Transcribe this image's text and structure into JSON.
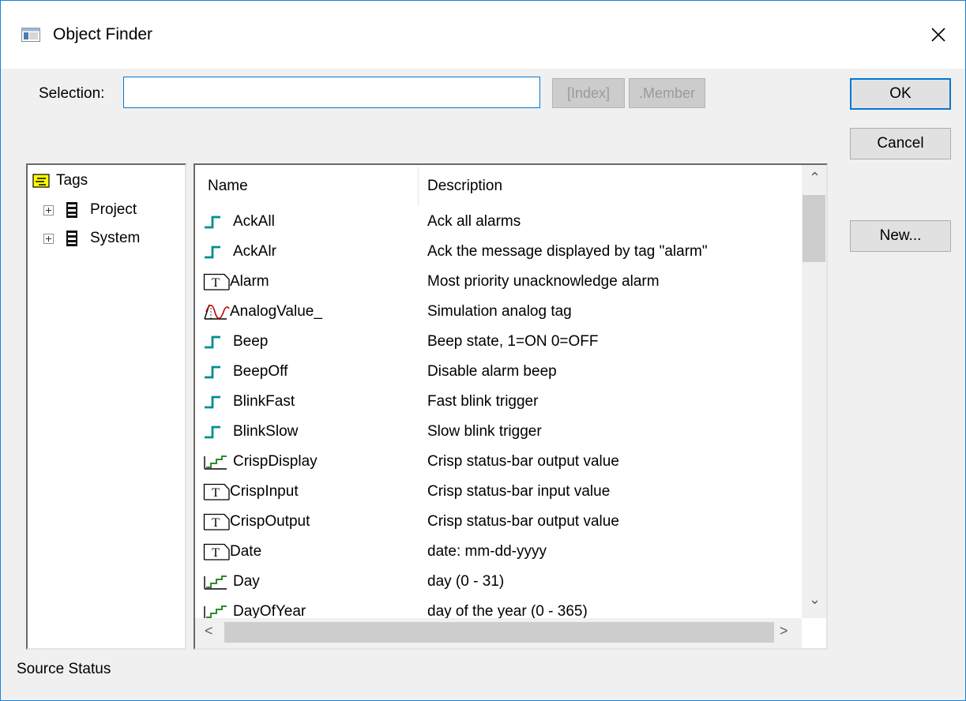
{
  "window": {
    "title": "Object Finder"
  },
  "selection": {
    "label": "Selection:",
    "value": "",
    "index_label": "[Index]",
    "member_label": ".Member"
  },
  "buttons": {
    "ok": "OK",
    "cancel": "Cancel",
    "new": "New..."
  },
  "tree": {
    "root": "Tags",
    "items": [
      {
        "label": "Project"
      },
      {
        "label": "System"
      }
    ]
  },
  "list": {
    "columns": {
      "name": "Name",
      "description": "Description"
    },
    "rows": [
      {
        "name": "AckAll",
        "description": "Ack all alarms",
        "icon": "digital-tag-icon"
      },
      {
        "name": "AckAlr",
        "description": "Ack the message displayed by tag \"alarm\"",
        "icon": "digital-tag-icon"
      },
      {
        "name": "Alarm",
        "description": "Most priority unacknowledge alarm",
        "icon": "text-tag-icon"
      },
      {
        "name": "AnalogValue_",
        "description": "Simulation analog tag",
        "icon": "analog-tag-icon"
      },
      {
        "name": "Beep",
        "description": "Beep state, 1=ON  0=OFF",
        "icon": "digital-tag-icon"
      },
      {
        "name": "BeepOff",
        "description": "Disable alarm beep",
        "icon": "digital-tag-icon"
      },
      {
        "name": "BlinkFast",
        "description": "Fast blink trigger",
        "icon": "digital-tag-icon"
      },
      {
        "name": "BlinkSlow",
        "description": "Slow blink trigger",
        "icon": "digital-tag-icon"
      },
      {
        "name": "CrispDisplay",
        "description": "Crisp status-bar output value",
        "icon": "integer-tag-icon"
      },
      {
        "name": "CrispInput",
        "description": "Crisp status-bar input value",
        "icon": "text-tag-icon"
      },
      {
        "name": "CrispOutput",
        "description": "Crisp status-bar output value",
        "icon": "text-tag-icon"
      },
      {
        "name": "Date",
        "description": "date: mm-dd-yyyy",
        "icon": "text-tag-icon"
      },
      {
        "name": "Day",
        "description": "day (0 - 31)",
        "icon": "integer-tag-icon"
      },
      {
        "name": "DayOfYear",
        "description": "day of the year (0 - 365)",
        "icon": "integer-tag-icon"
      }
    ]
  },
  "status": {
    "text": "Source Status"
  }
}
